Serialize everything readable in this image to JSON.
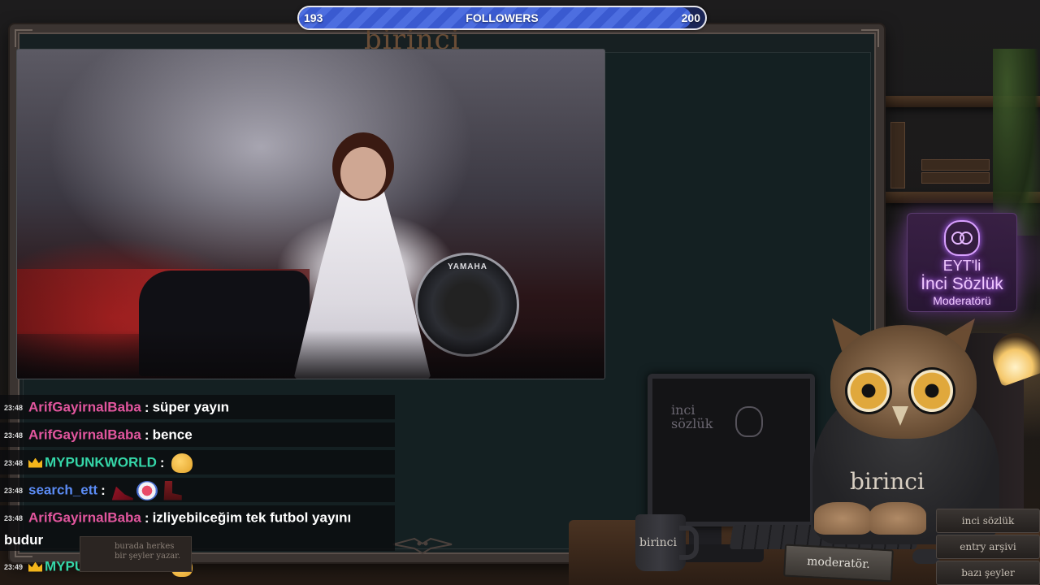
{
  "followers": {
    "current": "193",
    "label": "FOLLOWERS",
    "goal": "200",
    "progress": 0.965
  },
  "overlay_brand": "birinci",
  "video": {
    "drum_brand": "YAMAHA"
  },
  "chat": [
    {
      "time": "23:48",
      "user": "ArifGayirnalBaba",
      "user_color": "#e2569e",
      "badge": "",
      "text": "süper yayın",
      "emotes": []
    },
    {
      "time": "23:48",
      "user": "ArifGayirnalBaba",
      "user_color": "#e2569e",
      "badge": "",
      "text": "bence",
      "emotes": []
    },
    {
      "time": "23:48",
      "user": "MYPUNKWORLD",
      "user_color": "#35d6a8",
      "badge": "crown",
      "text": "",
      "emotes": [
        "emote-blob"
      ]
    },
    {
      "time": "23:48",
      "user": "search_ett",
      "user_color": "#5b8cf5",
      "badge": "",
      "text": "",
      "emotes": [
        "emote-heel",
        "emote-mouth",
        "emote-boot"
      ]
    },
    {
      "time": "23:48",
      "user": "ArifGayirnalBaba",
      "user_color": "#e2569e",
      "badge": "",
      "text": "izliyebilceğim tek futbol yayını",
      "continuation": "budur",
      "emotes": []
    },
    {
      "time": "23:49",
      "user": "MYPUNKWORLD",
      "user_color": "#35d6a8",
      "badge": "crown",
      "text": "",
      "emotes": [
        "emote-blob"
      ]
    }
  ],
  "note_card": {
    "line1": "burada herkes",
    "line2": "bir şeyler yazar."
  },
  "neon": {
    "line1": "EYT'li",
    "line2": "İnci Sözlük",
    "line3": "Moderatörü",
    "color": "#f0c8ff"
  },
  "desk": {
    "monitor_label_1": "inci",
    "monitor_label_2": "sözlük",
    "mug_label": "birinci",
    "owl_shirt": "birinci",
    "nameplate": "moderatör.",
    "books": [
      "inci sözlük",
      "entry arşivi",
      "bazı şeyler"
    ]
  },
  "colors": {
    "progress_fill": "#3a5ad0",
    "progress_bg": "#1a2556",
    "separator": ":"
  }
}
